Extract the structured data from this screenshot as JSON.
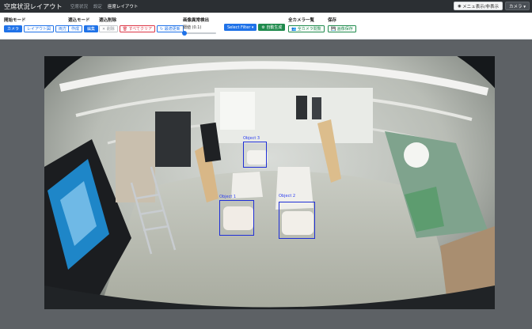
{
  "navbar": {
    "brand": "空席状況レイアウト",
    "links": [
      "空席状況",
      "設定",
      "座席レイアウト"
    ],
    "menu_toggle_label": "メニュ表示/非表示",
    "camera_menu_label": "カメラ ▾"
  },
  "toolbar": {
    "display_mode": {
      "label": "開始モード",
      "buttons": [
        "カメラ",
        "レイアウト図",
        "両方"
      ]
    },
    "edit_mode": {
      "label": "選込モード",
      "buttons": [
        "作成",
        "編集"
      ]
    },
    "delete": {
      "label": "選込削除",
      "buttons": [
        "削除",
        "すべてクリア",
        "最適更新"
      ]
    },
    "anomaly": {
      "label": "画像異常検出",
      "threshold_label": "閾値 (0.1)",
      "threshold_value": 0.1
    },
    "filter": {
      "select_label": "Select Filter",
      "auto_label": "自動生成"
    },
    "all_cameras": {
      "label": "全カメラ一覧",
      "button": "全カメラ閲覧"
    },
    "save": {
      "label": "保存",
      "button": "画像保存"
    }
  },
  "objects": [
    {
      "label": "Object 3"
    },
    {
      "label": "Object 1"
    },
    {
      "label": "Object 2"
    }
  ],
  "colors": {
    "primary": "#1f72e8",
    "success": "#1e8a4c",
    "danger": "#dc3545",
    "box": "#1f2fd6"
  }
}
